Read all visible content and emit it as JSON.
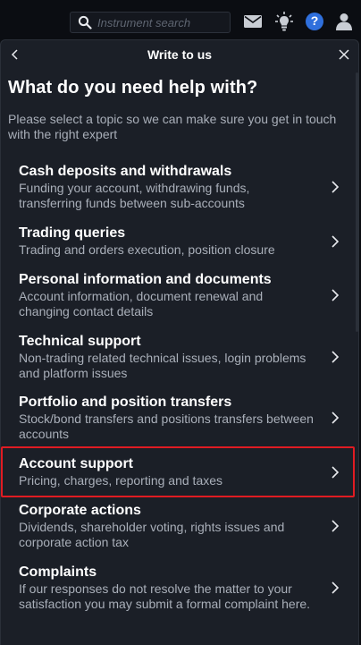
{
  "header": {
    "search": {
      "placeholder": "Instrument search"
    },
    "icons": [
      "search-icon",
      "mail-icon",
      "lightbulb-icon",
      "help-icon",
      "user-icon"
    ],
    "help_badge": "?"
  },
  "panel": {
    "title": "Write to us",
    "heading": "What do you need help with?",
    "intro": "Please select a topic so we can make sure you get in touch with the right expert",
    "topics": [
      {
        "title": "Cash deposits and withdrawals",
        "description": "Funding your account, withdrawing funds, transferring funds between sub-accounts"
      },
      {
        "title": "Trading queries",
        "description": "Trading and orders execution, position closure"
      },
      {
        "title": "Personal information and documents",
        "description": "Account information, document renewal and changing contact details"
      },
      {
        "title": "Technical support",
        "description": "Non-trading related technical issues, login problems and platform issues"
      },
      {
        "title": "Portfolio and position transfers",
        "description": "Stock/bond transfers and positions transfers between accounts"
      },
      {
        "title": "Account support",
        "description": "Pricing, charges, reporting and taxes"
      },
      {
        "title": "Corporate actions",
        "description": "Dividends, shareholder voting, rights issues and corporate action tax"
      },
      {
        "title": "Complaints",
        "description": "If our responses do not resolve the matter to your satisfaction you may submit a formal complaint here."
      }
    ]
  },
  "colors": {
    "background": "#0b0d12",
    "panel": "#1b1f27",
    "accent": "#2f6fdc",
    "selected_border": "#e01b22",
    "muted_text": "#a9afb9"
  }
}
